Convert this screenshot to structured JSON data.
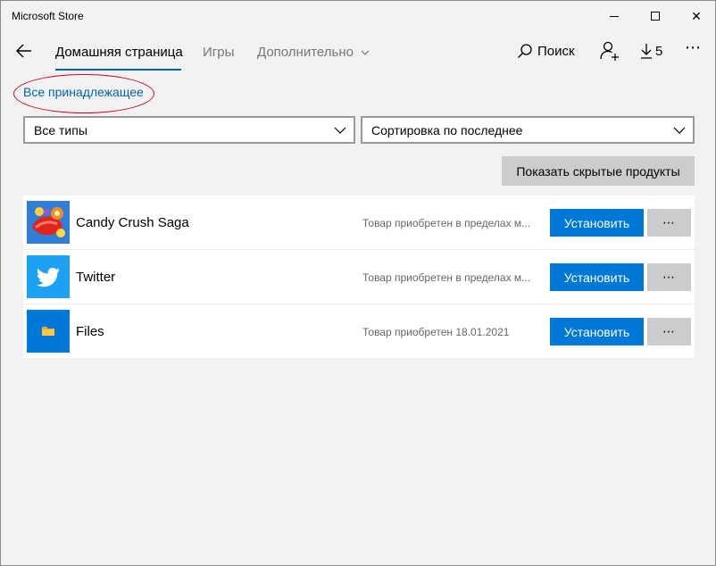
{
  "window": {
    "title": "Microsoft Store",
    "minimize_icon": "minimize-icon",
    "maximize_icon": "maximize-icon",
    "close_label": "✕"
  },
  "nav": {
    "tabs": [
      {
        "label": "Домашняя страница",
        "active": true
      },
      {
        "label": "Игры",
        "active": false
      },
      {
        "label": "Дополнительно",
        "active": false
      }
    ],
    "search_label": "Поиск",
    "downloads_count": "5",
    "more_label": "⋯",
    "accent_color": "#0063b1"
  },
  "library": {
    "owned_link": "Все принадлежащее",
    "filter_type": "Все типы",
    "sort": "Сортировка по последнее",
    "show_hidden_label": "Показать скрытые продукты",
    "items": [
      {
        "name": "Candy Crush Saga",
        "status": "Товар приобретен в пределах м...",
        "install_label": "Установить",
        "more_label": "⋯",
        "icon": "candy-crush-icon"
      },
      {
        "name": "Twitter",
        "status": "Товар приобретен в пределах м...",
        "install_label": "Установить",
        "more_label": "⋯",
        "icon": "twitter-icon"
      },
      {
        "name": "Files",
        "status": "Товар приобретен 18.01.2021",
        "install_label": "Установить",
        "more_label": "⋯",
        "icon": "files-icon"
      }
    ]
  },
  "colors": {
    "install_button": "#0078d7",
    "annotation_circle": "#d0021b"
  }
}
